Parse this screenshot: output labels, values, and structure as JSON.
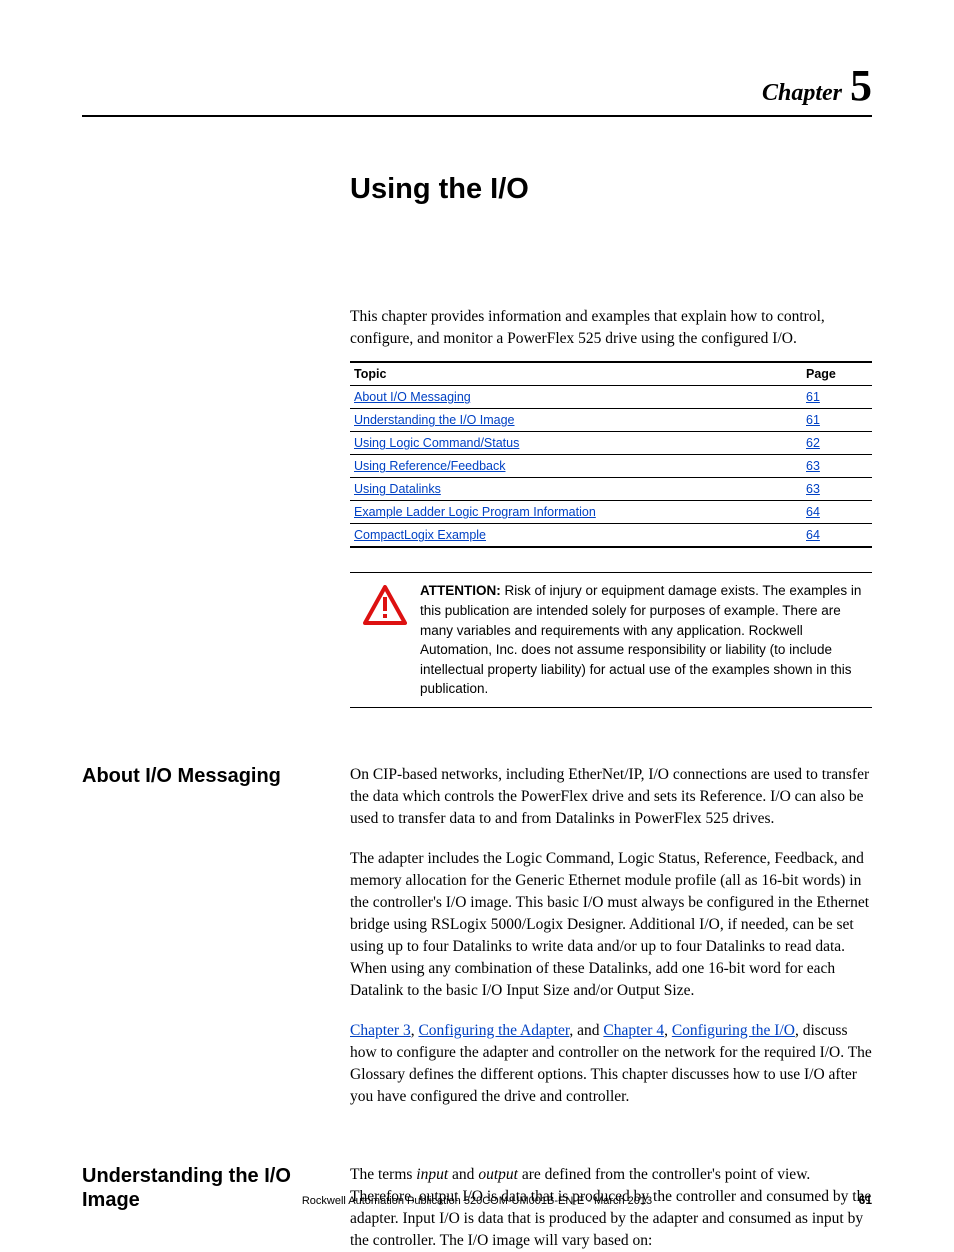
{
  "header": {
    "chapter_label": "Chapter",
    "chapter_num": "5"
  },
  "title": "Using the I/O",
  "intro": "This chapter provides information and examples that explain how to control, configure, and monitor a PowerFlex 525 drive using the configured I/O.",
  "topics": {
    "col_topic": "Topic",
    "col_page": "Page",
    "rows": [
      {
        "topic": "About I/O Messaging",
        "page": "61"
      },
      {
        "topic": "Understanding the I/O Image",
        "page": "61"
      },
      {
        "topic": "Using Logic Command/Status",
        "page": "62"
      },
      {
        "topic": "Using Reference/Feedback",
        "page": "63"
      },
      {
        "topic": "Using Datalinks",
        "page": "63"
      },
      {
        "topic": "Example Ladder Logic Program Information",
        "page": "64"
      },
      {
        "topic": "CompactLogix Example",
        "page": "64"
      }
    ]
  },
  "attention": {
    "label": "ATTENTION:",
    "text": "Risk of injury or equipment damage exists. The examples in this publication are intended solely for purposes of example. There are many variables and requirements with any application. Rockwell Automation, Inc. does not assume responsibility or liability (to include intellectual property liability) for actual use of the examples shown in this publication."
  },
  "section1": {
    "heading": "About I/O Messaging",
    "p1": "On CIP-based networks, including EtherNet/IP, I/O connections are used to transfer the data which controls the PowerFlex drive and sets its Reference. I/O can also be used to transfer data to and from Datalinks in PowerFlex 525 drives.",
    "p2": "The adapter includes the Logic Command, Logic Status, Reference, Feedback, and memory allocation for the Generic Ethernet module profile (all as 16-bit words) in the controller's I/O image. This basic I/O must always be configured in the Ethernet bridge using RSLogix 5000/Logix Designer. Additional I/O, if needed, can be set using up to four Datalinks to write data and/or up to four Datalinks to read data. When using any combination of these Datalinks, add one 16-bit word for each Datalink to the basic I/O Input Size and/or Output Size.",
    "p3_link1": "Chapter 3",
    "p3_sep1": ", ",
    "p3_link2": "Configuring the Adapter",
    "p3_sep2": ", and ",
    "p3_link3": "Chapter 4",
    "p3_sep3": ", ",
    "p3_link4": "Configuring the I/O",
    "p3_tail": ", discuss how to configure the adapter and controller on the network for the required I/O. The Glossary defines the different options. This chapter discusses how to use I/O after you have configured the drive and controller."
  },
  "section2": {
    "heading": "Understanding the I/O Image",
    "p1_a": "The terms ",
    "p1_em1": "input",
    "p1_b": " and ",
    "p1_em2": "output",
    "p1_c": " are defined from the controller's point of view. Therefore, output I/O is data that is produced by the controller and consumed by the adapter. Input I/O is data that is produced by the adapter and consumed as input by the controller. The I/O image will vary based on:"
  },
  "footer": {
    "pub": "Rockwell Automation Publication 520COM-UM001B-EN-E - March 2013",
    "page": "61"
  }
}
